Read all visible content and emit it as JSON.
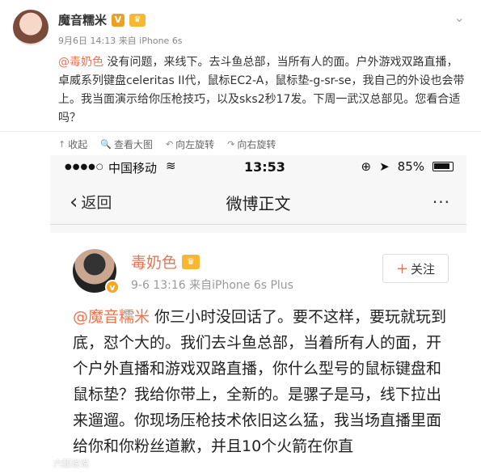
{
  "post": {
    "author": "魔音糯米",
    "v_badge": "V",
    "level_badge": "♛",
    "meta": "9月6日 14:13 来自 iPhone 6s",
    "text_mention": "@毒奶色",
    "text_body": " 没有问题，来线下。去斗鱼总部，当所有人的面。户外游戏双路直播，卓威系列键盘celeritas II代，鼠标EC2-A，鼠标垫-g-sr-se，我自己的外设也会带上。我当面演示给你压枪技巧，以及sks2秒17发。下周一武汉总部见。您看合适吗？",
    "actions": [
      {
        "icon": "↑",
        "label": "收起"
      },
      {
        "icon": "🔍",
        "label": "查看大图"
      },
      {
        "icon": "↶",
        "label": "向左旋转"
      },
      {
        "icon": "↷",
        "label": "向右旋转"
      }
    ]
  },
  "phone": {
    "carrier": "中国移动",
    "time": "13:53",
    "battery": "85%",
    "nav": {
      "back": "返回",
      "title": "微博正文",
      "more": "···"
    },
    "author": "毒奶色",
    "v_badge": "v",
    "level_badge": "♛",
    "meta": "9-6 13:16  来自iPhone 6s Plus",
    "follow_label": "关注",
    "mention": "@魔音糯米",
    "body": " 你三小时没回话了。要不这样，要玩就玩到底，怼个大的。我们去斗鱼总部，当着所有人的面，开个户外直播和游戏双路直播，你什么型号的鼠标键盘和鼠标垫？我给你带上，全新的。是骡子是马，线下拉出来遛遛。你现场压枪技术依旧这么猛，我当场直播里面给你和你粉丝道歉，并且10个火箭在你直"
  },
  "watermark": "六瓢说说"
}
